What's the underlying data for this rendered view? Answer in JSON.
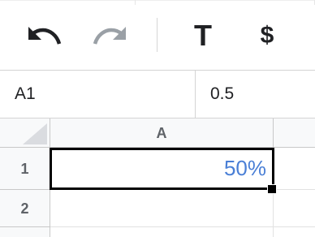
{
  "toolbar": {
    "undo_icon": "undo-icon",
    "redo_icon": "redo-icon",
    "text_format_glyph": "T",
    "currency_format_glyph": "$"
  },
  "formula_bar": {
    "cell_reference": "A1",
    "value": "0.5"
  },
  "sheet": {
    "columns": [
      "A"
    ],
    "rows": [
      "1",
      "2"
    ],
    "cells": {
      "A1": "50%",
      "A2": ""
    },
    "selected_cell": "A1",
    "value_color": "#4a7fd6"
  }
}
